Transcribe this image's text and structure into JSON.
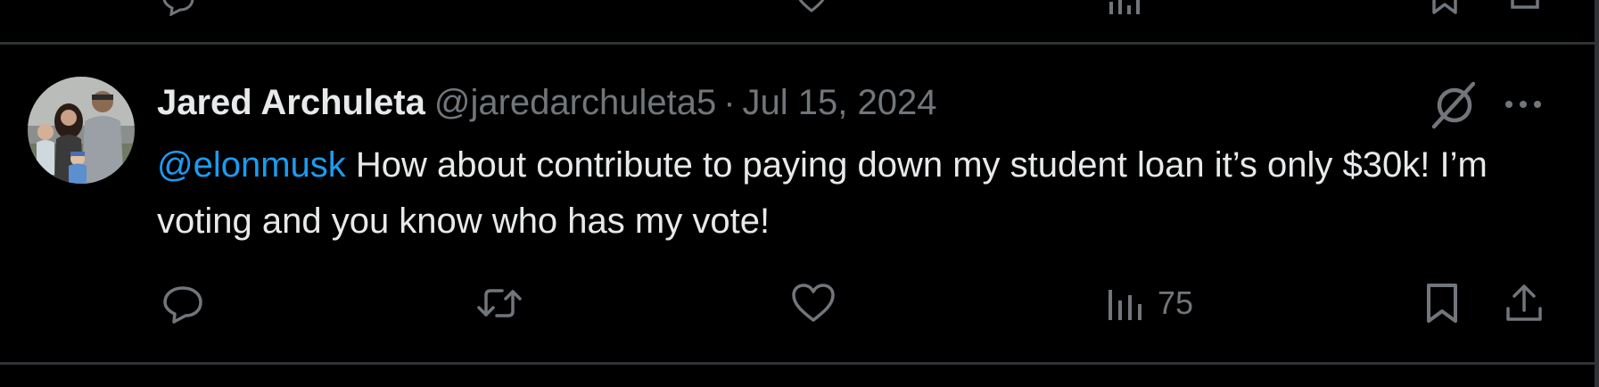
{
  "tweet": {
    "display_name": "Jared Archuleta",
    "handle": "@jaredarchuleta5",
    "separator": "·",
    "date": "Jul 15, 2024",
    "mention": "@elonmusk",
    "text": " How about contribute to paying down my student loan it’s only $30k! I’m voting and you know who has my vote!",
    "stats": {
      "views": "75"
    }
  },
  "icons": {
    "avatar": "profile-photo",
    "grok": "grok-icon",
    "more": "more-horizontal-icon",
    "reply": "reply-icon",
    "repost": "repost-icon",
    "like": "heart-icon",
    "views": "views-icon",
    "bookmark": "bookmark-icon",
    "share": "share-icon"
  },
  "colors": {
    "background": "#000000",
    "text_primary": "#e7e9ea",
    "text_secondary": "#71767b",
    "mention": "#1d9bf0",
    "divider": "#2f3336"
  }
}
